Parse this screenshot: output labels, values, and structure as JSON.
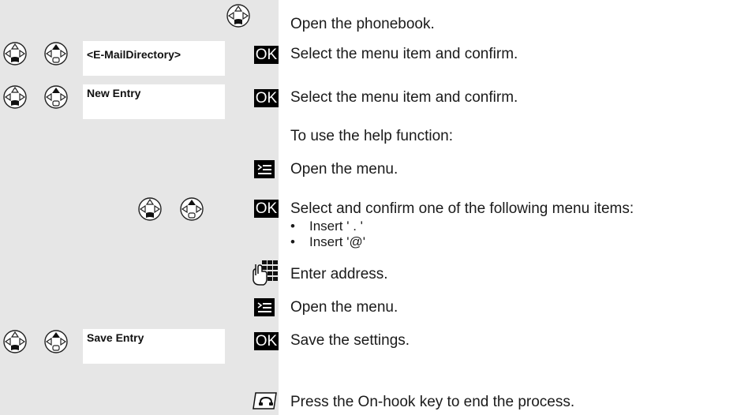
{
  "steps": [
    {
      "text": "Open the phonebook."
    },
    {
      "text": "Select the menu item and confirm.",
      "menu_item": "<E-MailDirectory>",
      "key": "OK"
    },
    {
      "text": "Select the menu item and confirm.",
      "menu_item": "New Entry",
      "key": "OK"
    },
    {
      "text": "To use the help function:"
    },
    {
      "text": "Open the menu."
    },
    {
      "text": "Select and confirm one of the following menu items:",
      "key": "OK",
      "options": [
        "Insert ' . '",
        "Insert '@'"
      ]
    },
    {
      "text": "Enter address."
    },
    {
      "text": "Open the menu."
    },
    {
      "text": "Save the settings.",
      "menu_item": "Save Entry",
      "key": "OK"
    },
    {
      "text": "Press the On-hook key to end the process."
    }
  ],
  "icons": {
    "nav_key": "control-key-icon",
    "menu_key": "menu-key-icon",
    "keypad": "keypad-icon",
    "onhook": "on-hook-key-icon"
  }
}
